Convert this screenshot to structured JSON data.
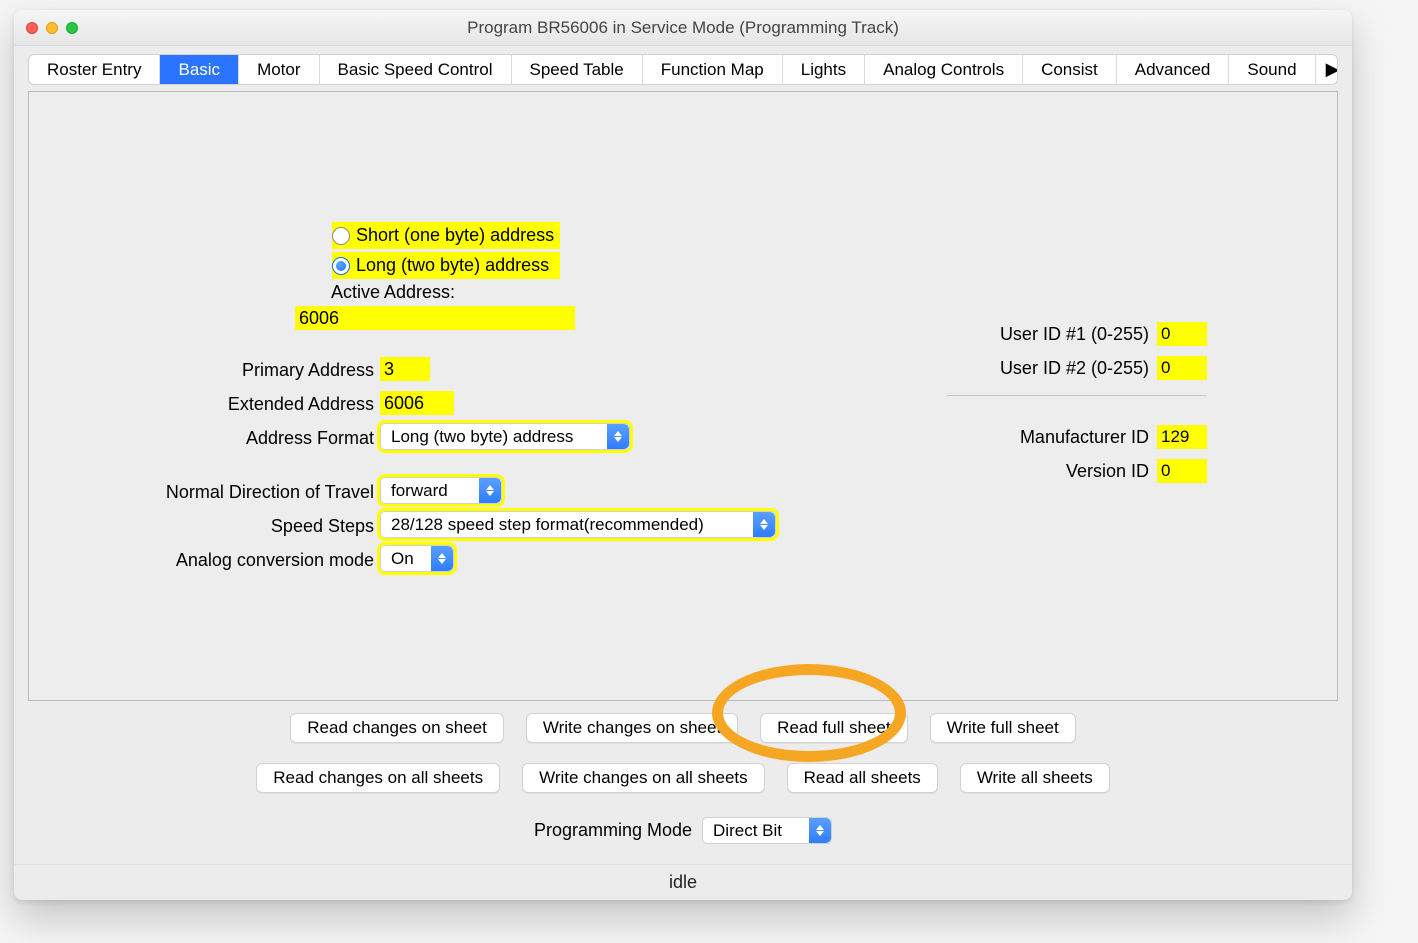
{
  "window": {
    "title": "Program BR56006 in Service Mode (Programming Track)"
  },
  "tabs": [
    "Roster Entry",
    "Basic",
    "Motor",
    "Basic Speed Control",
    "Speed Table",
    "Function Map",
    "Lights",
    "Analog Controls",
    "Consist",
    "Advanced",
    "Sound"
  ],
  "address": {
    "radio_short": "Short (one byte) address",
    "radio_long": "Long (two byte) address",
    "active_label": "Active Address:",
    "active_value": "6006"
  },
  "fields": {
    "primary_address_label": "Primary Address",
    "primary_address_value": "3",
    "extended_address_label": "Extended Address",
    "extended_address_value": "6006",
    "address_format_label": "Address Format",
    "address_format_value": "Long (two byte) address",
    "direction_label": "Normal Direction of Travel",
    "direction_value": "forward",
    "speed_steps_label": "Speed Steps",
    "speed_steps_value": "28/128 speed step format(recommended)",
    "analog_label": "Analog conversion mode",
    "analog_value": "On"
  },
  "right": {
    "user_id1_label": "User ID #1 (0-255)",
    "user_id1_value": "0",
    "user_id2_label": "User ID #2 (0-255)",
    "user_id2_value": "0",
    "manufacturer_label": "Manufacturer ID",
    "manufacturer_value": "129",
    "version_label": "Version ID",
    "version_value": "0"
  },
  "buttons": {
    "row1": [
      "Read changes on sheet",
      "Write changes on sheet",
      "Read full sheet",
      "Write full sheet"
    ],
    "row2": [
      "Read changes on all sheets",
      "Write changes on all sheets",
      "Read all sheets",
      "Write all sheets"
    ]
  },
  "programming_mode": {
    "label": "Programming Mode",
    "value": "Direct Bit"
  },
  "status": "idle"
}
